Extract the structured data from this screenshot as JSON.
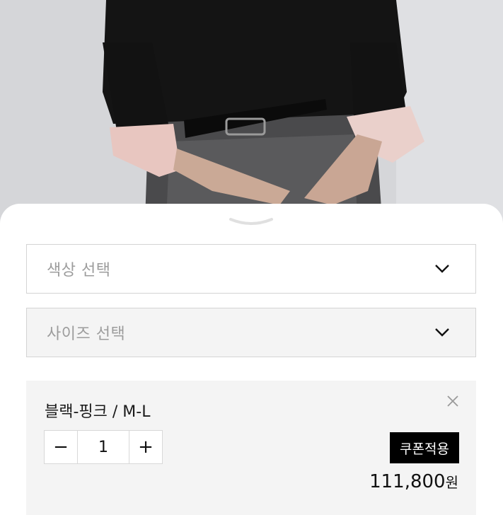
{
  "colors": {
    "sheet_bg": "#ffffff",
    "select_border": "#d4d4d4",
    "option_bg": "#f4f4f4",
    "coupon_bg": "#000000"
  },
  "photo": {
    "description_icon": "product-model-photo"
  },
  "options": {
    "color_placeholder": "색상 선택",
    "size_placeholder": "사이즈 선택"
  },
  "selected_item": {
    "name": "블랙-핑크 / M-L",
    "quantity": "1",
    "minus_label": "−",
    "plus_label": "+",
    "coupon_label": "쿠폰적용",
    "price": "111,800",
    "currency": "원"
  },
  "icons": {
    "remove": "close-icon",
    "dropdown": "chevron-down-icon",
    "handle": "sheet-handle"
  }
}
